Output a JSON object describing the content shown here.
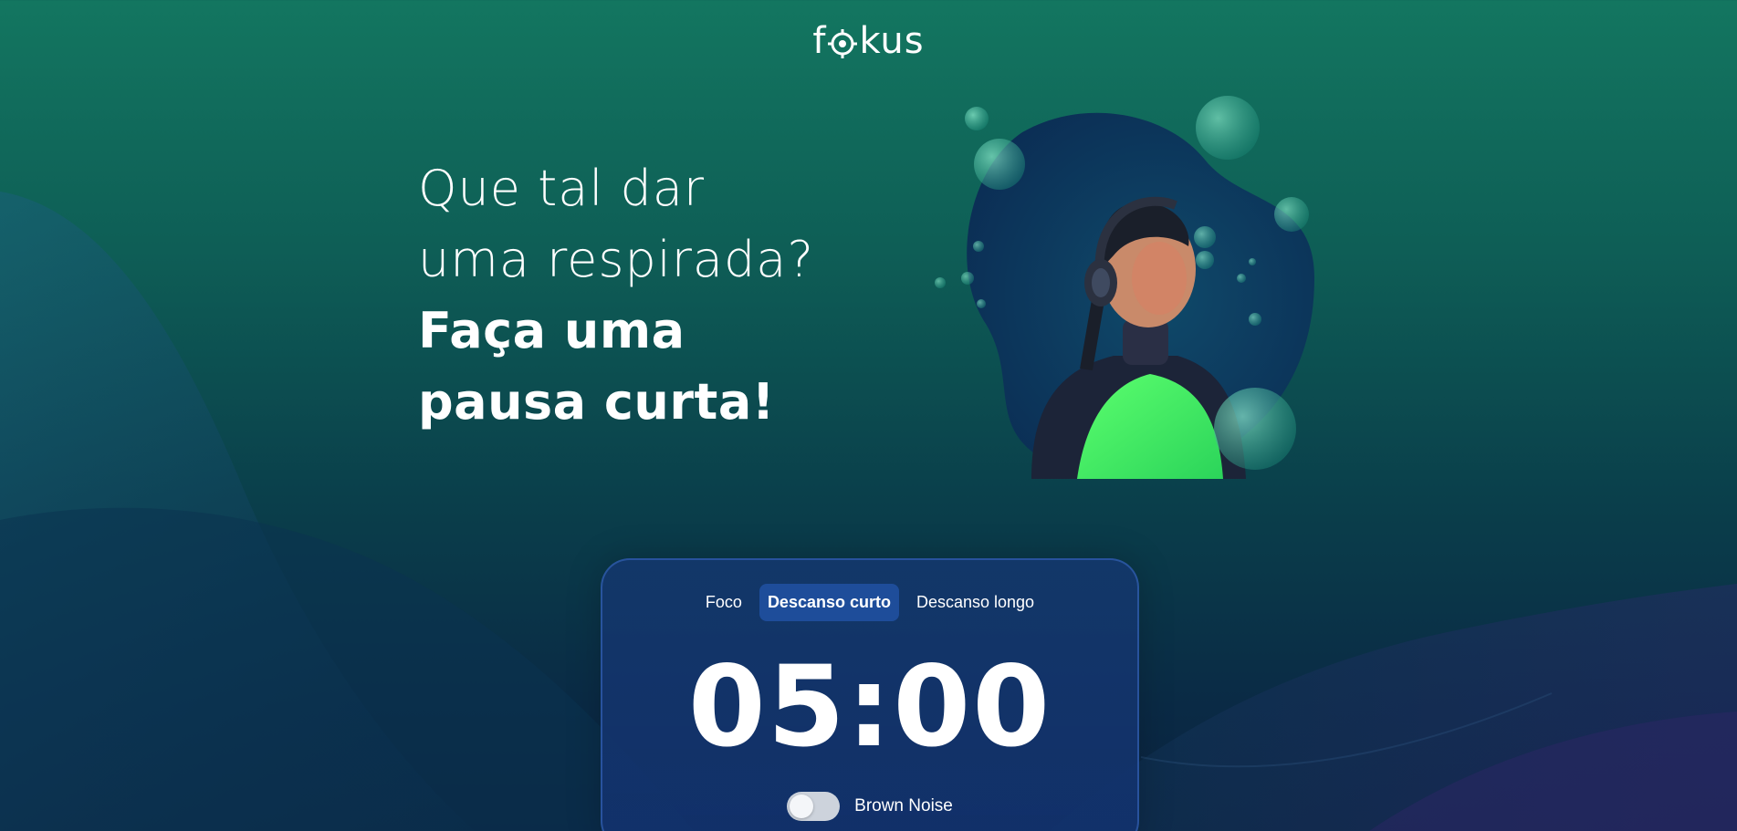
{
  "brand": {
    "logo_prefix": "f",
    "logo_suffix": "kus",
    "logo_icon": "target-icon"
  },
  "headline": {
    "line1": "Que tal dar",
    "line2": "uma respirada?",
    "line3": "Faça uma",
    "line4": "pausa curta!"
  },
  "tabs": [
    {
      "label": "Foco",
      "active": false
    },
    {
      "label": "Descanso curto",
      "active": true
    },
    {
      "label": "Descanso longo",
      "active": false
    }
  ],
  "timer": {
    "display": "05:00"
  },
  "brown_noise": {
    "label": "Brown Noise",
    "enabled": false
  },
  "colors": {
    "bg_top": "#137660",
    "bg_bottom": "#0b2340",
    "card": "#14376e",
    "tab_active": "#1e4d9a",
    "accent_green": "#4cf06a"
  },
  "illustration": {
    "subject": "woman-with-headphones-and-bubbles"
  }
}
